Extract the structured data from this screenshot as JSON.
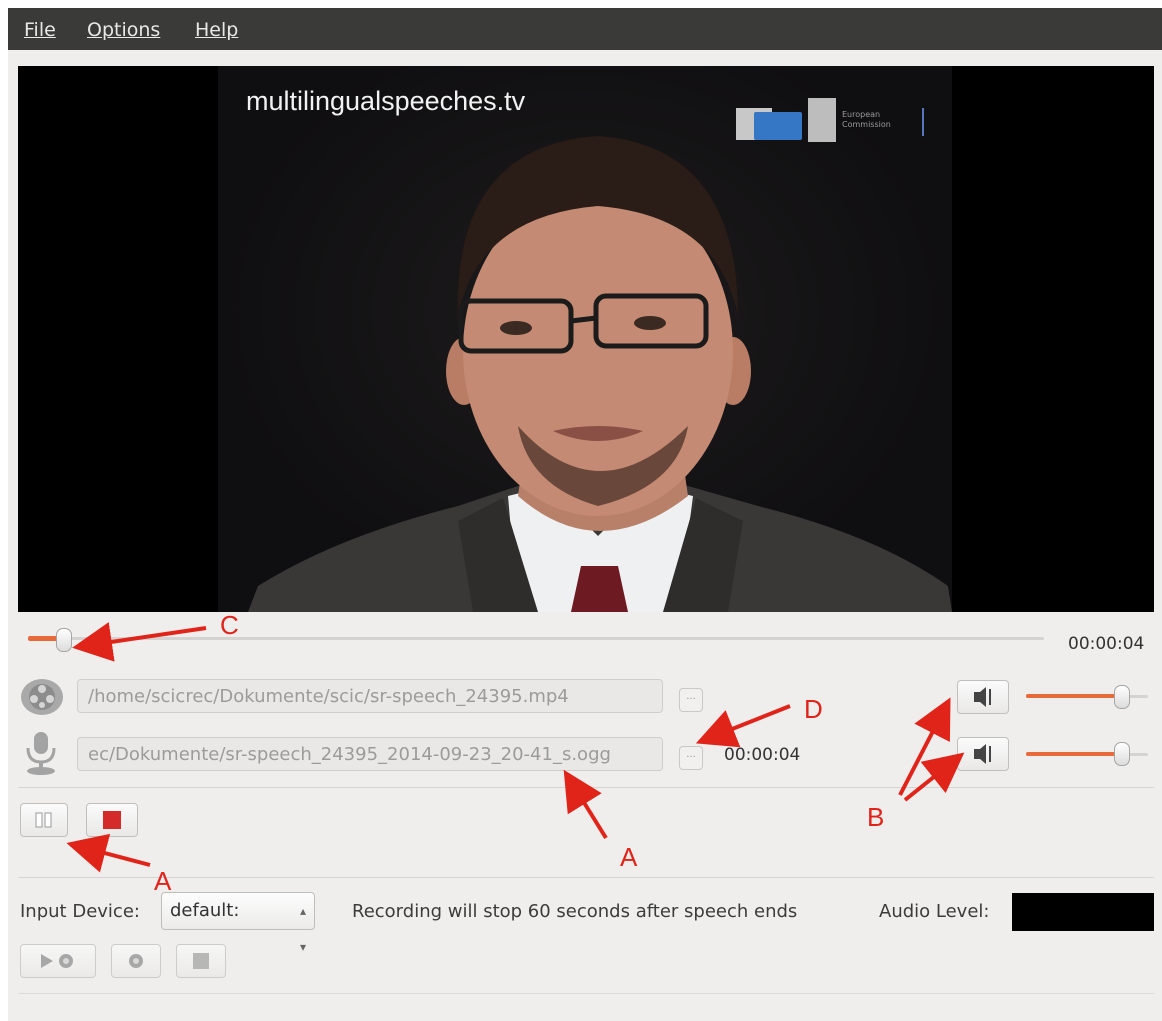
{
  "menu": {
    "file": "File",
    "options": "Options",
    "help": "Help"
  },
  "video": {
    "watermark": "multilingualspeeches.tv",
    "logo_text_1": "European",
    "logo_text_2": "Commission"
  },
  "seek": {
    "time": "00:00:04",
    "position_fraction": 0.04
  },
  "sources": {
    "video_path": "/home/scicrec/Dokumente/scic/sr-speech_24395.mp4",
    "audio_path": "ec/Dokumente/sr-speech_24395_2014-09-23_20-41_s.ogg",
    "audio_time": "00:00:04",
    "browse_label": "...",
    "video_volume_fraction": 0.8,
    "audio_volume_fraction": 0.8
  },
  "recorder": {
    "input_device_label": "Input Device:",
    "input_device_value": "default:",
    "info_text": "Recording will stop 60 seconds after speech ends",
    "audio_level_label": "Audio Level:"
  },
  "annotations": {
    "a1": "A",
    "a2": "A",
    "b": "B",
    "c": "C",
    "d": "D",
    "color": "#e0241a"
  },
  "colors": {
    "accent": "#e86a3b",
    "stop_red": "#d42a2a"
  }
}
